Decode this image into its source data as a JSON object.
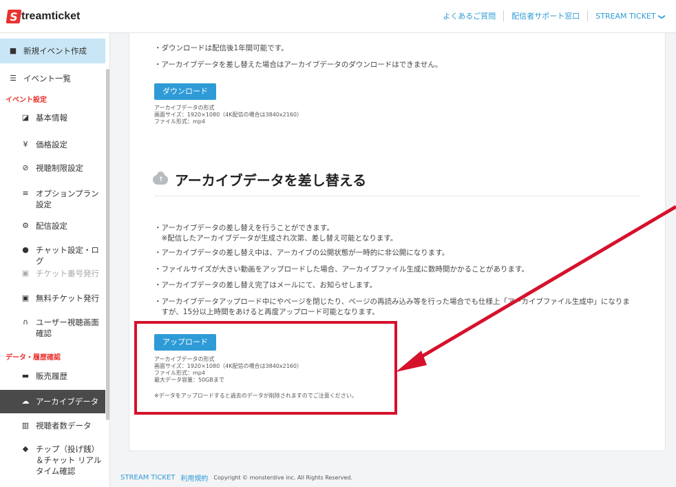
{
  "header": {
    "logo_letter": "S",
    "logo_text": "treamticket",
    "links": [
      "よくあるご質問",
      "配信者サポート窓口",
      "STREAM TICKET"
    ],
    "chevron": "❯"
  },
  "sidebar": {
    "items": [
      {
        "label": "新規イベント作成",
        "icon": "video-icon"
      },
      {
        "label": "イベント一覧",
        "icon": "list-icon"
      },
      {
        "label": "基本情報",
        "icon": "edit-icon"
      },
      {
        "label": "価格設定",
        "icon": "yen-icon"
      },
      {
        "label": "視聴制限設定",
        "icon": "eye-slash-icon"
      },
      {
        "label": "オプションプラン設定",
        "icon": "sliders-icon"
      },
      {
        "label": "配信設定",
        "icon": "cogs-icon"
      },
      {
        "label": "チャット設定・ログ",
        "icon": "comments-icon"
      },
      {
        "label": "チケット番号発行",
        "icon": "ticket-icon"
      },
      {
        "label": "無料チケット発行",
        "icon": "ticket-icon"
      },
      {
        "label": "ユーザー視聴画面確認",
        "icon": "headphones-icon"
      },
      {
        "label": "販売履歴",
        "icon": "credit-card-icon"
      },
      {
        "label": "アーカイブデータ",
        "icon": "cloud-upload-icon"
      },
      {
        "label": "視聴者数データ",
        "icon": "chart-icon"
      },
      {
        "label": "チップ（投げ銭）＆チャット リアルタイム確認",
        "icon": "tip-icon"
      }
    ],
    "section_event": "イベント設定",
    "section_data": "データ・履歴確認"
  },
  "main": {
    "download_bullets": [
      "・ダウンロードは配信後1年間可能です。",
      "・アーカイブデータを差し替えた場合はアーカイブデータのダウンロードはできません。"
    ],
    "download_button": "ダウンロード",
    "download_spec": [
      "アーカイブデータの形式",
      "画面サイズ：1920×1080（4K配信の場合は3840x2160）",
      "ファイル形式：mp4"
    ],
    "section_title": "アーカイブデータを差し替える",
    "replace_bullets": [
      "・アーカイブデータの差し替えを行うことができます。",
      "　※配信したアーカイブデータが生成され次第、差し替え可能となります。",
      "・アーカイブデータの差し替え中は、アーカイブの公開状態が一時的に非公開になります。",
      "・ファイルサイズが大きい動画をアップロードした場合、アーカイブファイル生成に数時間かかることがあります。",
      "・アーカイブデータの差し替え完了はメールにて、お知らせします。",
      "・アーカイブデータアップロード中にやページを閉じたり、ページの再読み込み等を行った場合でも仕様上「アーカイブファイル生成中」になりま",
      "　すが、15分以上時間をあけると再度アップロード可能となります。"
    ],
    "upload_button": "アップロード",
    "upload_spec": [
      "アーカイブデータの形式",
      "画面サイズ：1920×1080（4K配信の場合は3840x2160）",
      "ファイル形式：mp4",
      "最大データ容量：50GBまで"
    ],
    "upload_note": "※データをアップロードすると過去のデータが削除されますのでご注意ください。"
  },
  "footer": {
    "brand": "STREAM TICKET",
    "terms": "利用規約",
    "copyright": "Copyright © monsterdive inc. All Rights Reserved."
  },
  "colors": {
    "accent": "#2e9bd6",
    "brand": "#e8322f",
    "highlight": "#d6112c"
  }
}
